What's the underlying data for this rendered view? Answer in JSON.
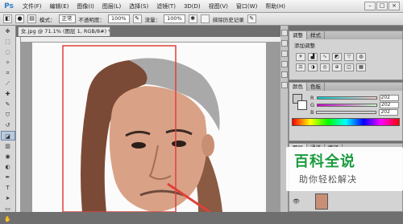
{
  "app": {
    "logo": "Ps"
  },
  "menu": [
    "文件(F)",
    "编辑(E)",
    "图像(I)",
    "图层(L)",
    "选择(S)",
    "滤镜(T)",
    "3D(D)",
    "视图(V)",
    "窗口(W)",
    "帮助(H)"
  ],
  "options": {
    "mode_label": "模式：",
    "mode_value": "正常",
    "opacity_label": "不透明度：",
    "opacity_value": "100%",
    "flow_label": "流量：",
    "flow_value": "100%",
    "history_label": "抹除历史记录"
  },
  "document": {
    "tab_title": "女.jpg @ 71.1% (图层 1, RGB/8#) *"
  },
  "panels": {
    "adjust_tabs": [
      "调整",
      "样式"
    ],
    "adjust_title": "添加调整",
    "color_tabs": [
      "颜色",
      "色板"
    ],
    "color_rows": [
      {
        "label": "R",
        "value": "202"
      },
      {
        "label": "G",
        "value": "202"
      },
      {
        "label": "B",
        "value": "202"
      }
    ],
    "layers_tabs": [
      "图层",
      "通道",
      "路径"
    ]
  },
  "watermark": {
    "title": "百科全说",
    "subtitle": "助你轻松解决"
  },
  "colors": {
    "accent": "#1a9b3e",
    "guide": "#e0403a",
    "ps_blue": "#2c7fc8"
  }
}
